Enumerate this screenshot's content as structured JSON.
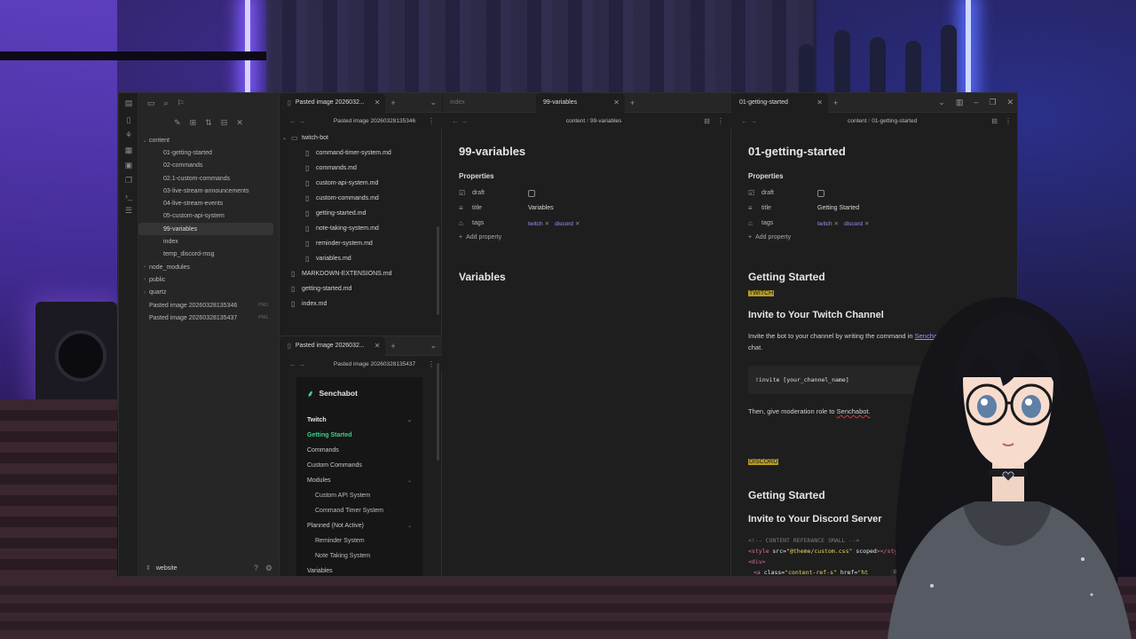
{
  "sidebar": {
    "tree": [
      {
        "label": "content",
        "kind": "folder-open",
        "depth": 0
      },
      {
        "label": "01-getting-started",
        "depth": 1
      },
      {
        "label": "02-commands",
        "depth": 1
      },
      {
        "label": "02.1-custom-commands",
        "depth": 1
      },
      {
        "label": "03-live-stream-announcements",
        "depth": 1
      },
      {
        "label": "04-live-stream-events",
        "depth": 1
      },
      {
        "label": "05-custom-api-system",
        "depth": 1
      },
      {
        "label": "99-variables",
        "depth": 1,
        "active": true
      },
      {
        "label": "index",
        "depth": 1
      },
      {
        "label": "temp_discord-msg",
        "depth": 1
      },
      {
        "label": "node_modules",
        "kind": "folder",
        "depth": 0
      },
      {
        "label": "public",
        "kind": "folder",
        "depth": 0
      },
      {
        "label": "quartz",
        "kind": "folder",
        "depth": 0
      },
      {
        "label": "Pasted image 20260328135346",
        "tag": "PNG",
        "depth": 0
      },
      {
        "label": "Pasted image 20260328135437",
        "tag": "PNG",
        "depth": 0
      }
    ],
    "vault_name": "website"
  },
  "file_pane": {
    "tab_label": "Pasted image 2026032...",
    "breadcrumb": "Pasted image 20260328135346",
    "items": [
      {
        "label": "twitch-bot",
        "kind": "folder",
        "indent": 0
      },
      {
        "label": "command-timer-system.md",
        "kind": "file",
        "indent": 1
      },
      {
        "label": "commands.md",
        "kind": "file",
        "indent": 1
      },
      {
        "label": "custom-api-system.md",
        "kind": "file",
        "indent": 1
      },
      {
        "label": "custom-commands.md",
        "kind": "file",
        "indent": 1
      },
      {
        "label": "getting-started.md",
        "kind": "file",
        "indent": 1
      },
      {
        "label": "note-taking-system.md",
        "kind": "file",
        "indent": 1
      },
      {
        "label": "reminder-system.md",
        "kind": "file",
        "indent": 1
      },
      {
        "label": "variables.md",
        "kind": "file",
        "indent": 1
      },
      {
        "label": "MARKDOWN-EXTENSIONS.md",
        "kind": "file",
        "indent": 0
      },
      {
        "label": "getting-started.md",
        "kind": "file",
        "indent": 0
      },
      {
        "label": "index.md",
        "kind": "file",
        "indent": 0
      }
    ]
  },
  "web_pane": {
    "tab_label": "Pasted image 2026032...",
    "breadcrumb": "Pasted image 20260328135437",
    "site_name": "Senchabot",
    "nav": [
      {
        "label": "Twitch",
        "style": "h",
        "chev": "⌄"
      },
      {
        "label": "Getting Started",
        "style": "on"
      },
      {
        "label": "Commands",
        "style": ""
      },
      {
        "label": "Custom Commands",
        "style": ""
      },
      {
        "label": "Modules",
        "style": "",
        "chev": "⌄"
      },
      {
        "label": "Custom API System",
        "style": "sub"
      },
      {
        "label": "Command Timer System",
        "style": "sub"
      },
      {
        "label": "Planned (Not Active)",
        "style": "",
        "chev": "⌄"
      },
      {
        "label": "Reminder System",
        "style": "sub"
      },
      {
        "label": "Note Taking System",
        "style": "sub"
      },
      {
        "label": "Variables",
        "style": ""
      }
    ]
  },
  "middle_pane": {
    "tabs": [
      {
        "label": "index"
      },
      {
        "label": "99-variables"
      }
    ],
    "crumb_folder": "content",
    "crumb_note": "99-variables",
    "title": "99-variables",
    "properties_heading": "Properties",
    "props": {
      "draft": "draft",
      "title_key": "title",
      "title_val": "Variables",
      "tags_key": "tags",
      "tags": [
        "twitch",
        "discord"
      ]
    },
    "add_property": "Add property",
    "heading": "Variables"
  },
  "right_pane": {
    "tab_label": "01-getting-started",
    "crumb_folder": "content",
    "crumb_note": "01-getting-started",
    "title": "01-getting-started",
    "properties_heading": "Properties",
    "props": {
      "draft": "draft",
      "title_key": "title",
      "title_val": "Getting Started",
      "tags_key": "tags",
      "tags": [
        "twitch",
        "discord"
      ]
    },
    "add_property": "Add property",
    "h2_a": "Getting Started",
    "badge_twitch": "TWITCH",
    "h3_a": "Invite to Your Twitch Channel",
    "p1_pre": "Invite the bot to your channel by writing the command in ",
    "p1_link": "Senchabot",
    "p1_post": "chat.",
    "code": "!invite [your_channel_name]",
    "p2_pre": "Then, give moderation role to ",
    "p2_word": "Senchabot.",
    "badge_discord": "DISCORD",
    "h2_b": "Getting Started",
    "h3_b": "Invite to Your Discord Server",
    "src_comment": "<!-- CONTENT REFERANCE SMALL -->",
    "src_style_open": "<style",
    "src_style_attr": " src=",
    "src_style_val": "\"@theme/custom.css\"",
    "src_style_attr2": " scoped",
    "src_style_close": "></style>",
    "src_div": "<div>",
    "src_a_open": "<a",
    "src_a_attr": " class=",
    "src_a_val": "\"content-ref-s\"",
    "src_a_attr2": " href=",
    "src_a_val2": "\"ht",
    "backlinks": "0 backlinks"
  }
}
